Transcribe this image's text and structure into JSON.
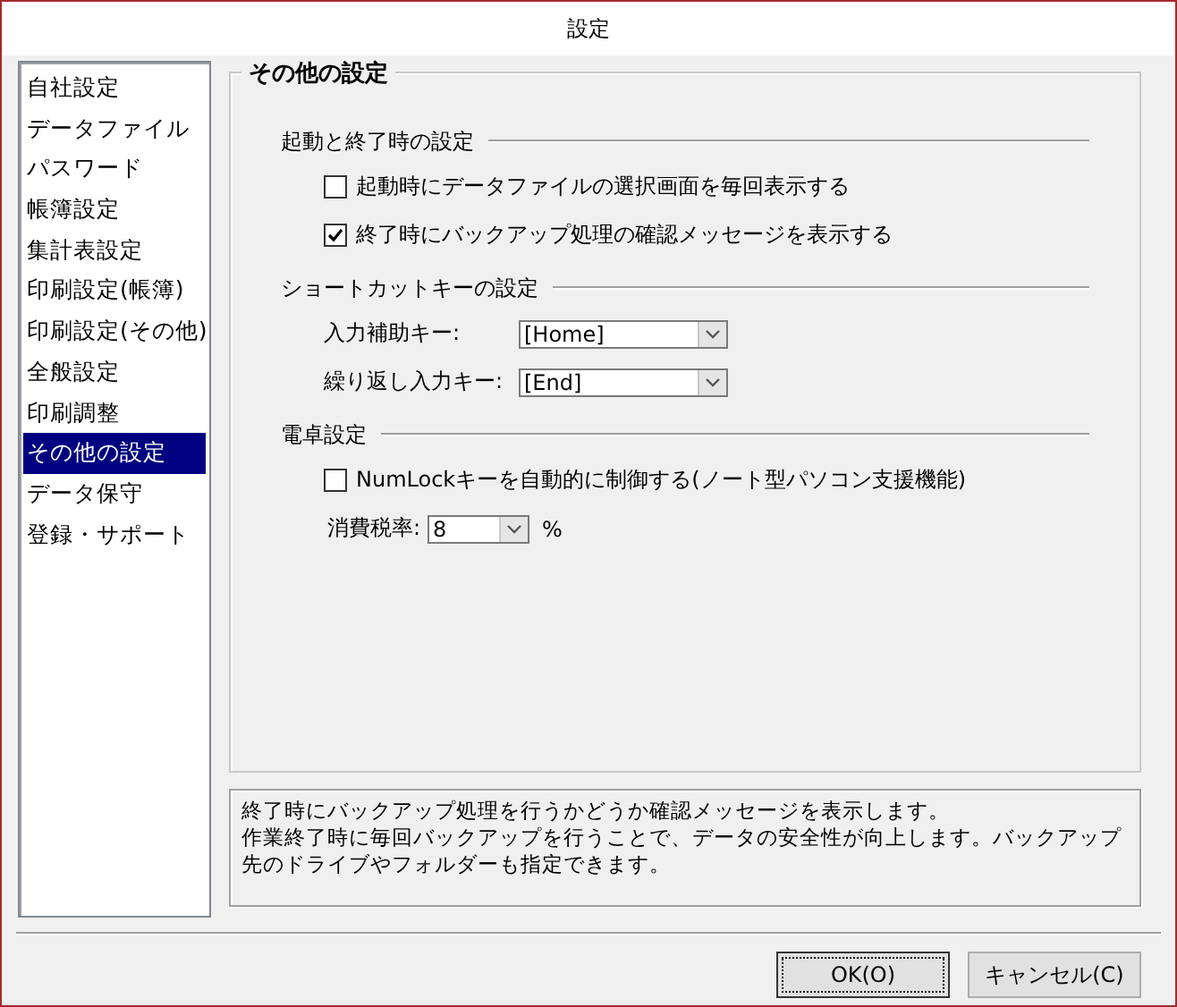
{
  "window": {
    "title": "設定"
  },
  "sidebar": {
    "items": [
      {
        "label": "自社設定",
        "selected": false
      },
      {
        "label": "データファイル",
        "selected": false
      },
      {
        "label": "パスワード",
        "selected": false
      },
      {
        "label": "帳簿設定",
        "selected": false
      },
      {
        "label": "集計表設定",
        "selected": false
      },
      {
        "label": "印刷設定(帳簿)",
        "selected": false
      },
      {
        "label": "印刷設定(その他)",
        "selected": false
      },
      {
        "label": "全般設定",
        "selected": false
      },
      {
        "label": "印刷調整",
        "selected": false
      },
      {
        "label": "その他の設定",
        "selected": true
      },
      {
        "label": "データ保守",
        "selected": false
      },
      {
        "label": "登録・サポート",
        "selected": false
      }
    ]
  },
  "panel": {
    "title": "その他の設定",
    "sections": [
      {
        "title": "起動と終了時の設定",
        "items": [
          {
            "kind": "checkbox",
            "label": "起動時にデータファイルの選択画面を毎回表示する",
            "checked": false
          },
          {
            "kind": "checkbox",
            "label": "終了時にバックアップ処理の確認メッセージを表示する",
            "checked": true
          }
        ]
      },
      {
        "title": "ショートカットキーの設定",
        "items": [
          {
            "kind": "select",
            "label": "入力補助キー:",
            "value": "[Home]"
          },
          {
            "kind": "select",
            "label": "繰り返し入力キー:",
            "value": "[End]"
          }
        ]
      },
      {
        "title": "電卓設定",
        "items": [
          {
            "kind": "checkbox",
            "label": "NumLockキーを自動的に制御する(ノート型パソコン支援機能)",
            "checked": false
          },
          {
            "kind": "select",
            "label": "消費税率:",
            "value": "8",
            "unit": "%"
          }
        ]
      }
    ]
  },
  "description": [
    "終了時にバックアップ処理を行うかどうか確認メッセージを表示します。",
    "作業終了時に毎回バックアップを行うことで、データの安全性が向上します。バックアップ先のドライブやフォルダーも指定できます。"
  ],
  "buttons": [
    {
      "label": "OK(O)",
      "default": true
    },
    {
      "label": "キャンセル(C)",
      "default": false
    }
  ]
}
